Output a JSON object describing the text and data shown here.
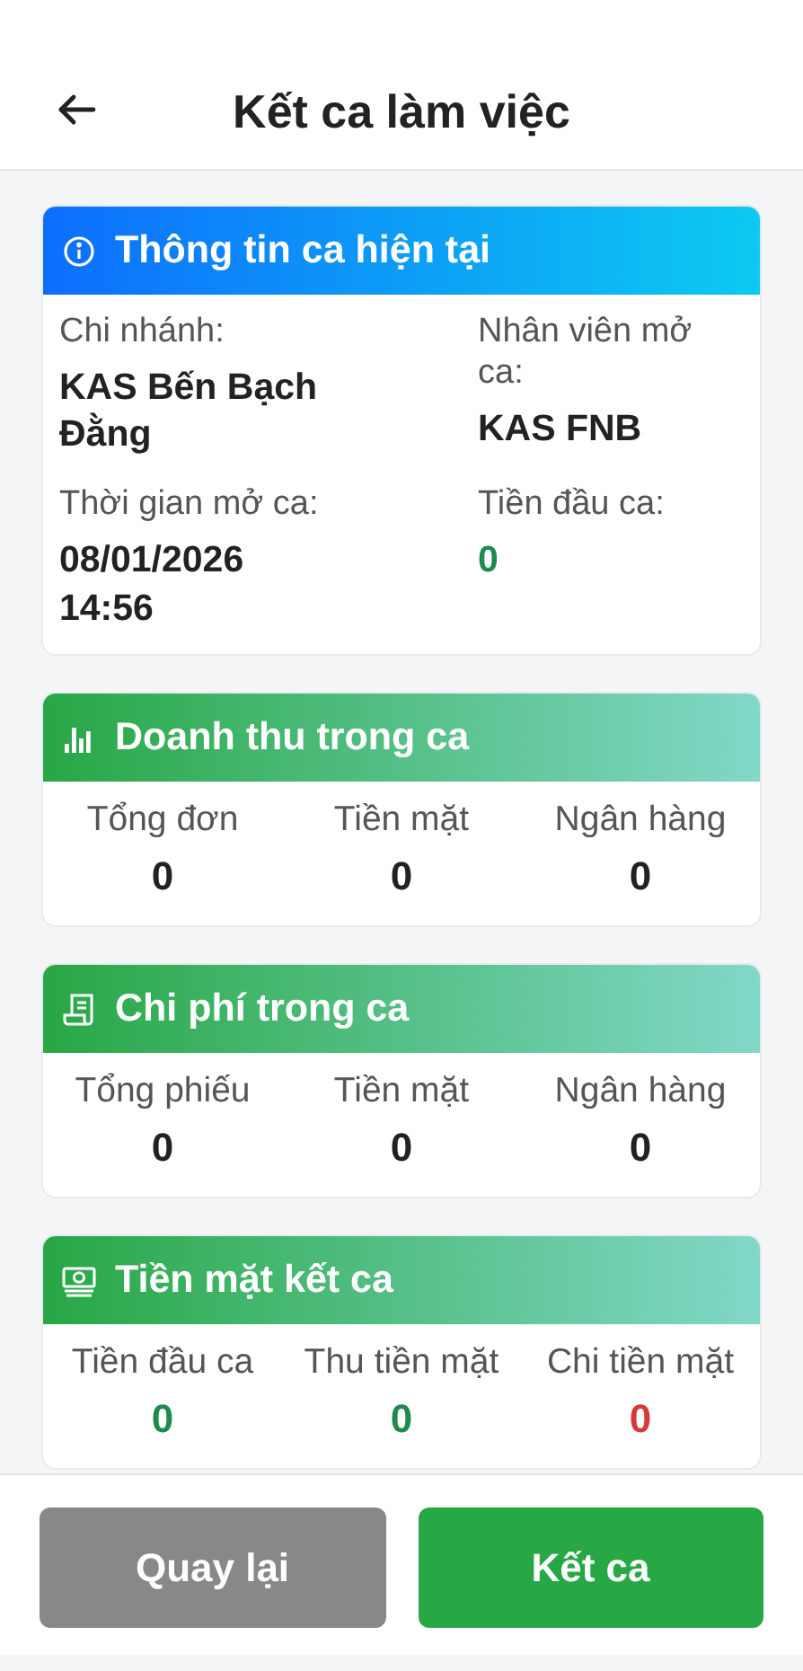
{
  "header": {
    "title": "Kết ca làm việc"
  },
  "sections": [
    {
      "kind": "info",
      "title": "Thông tin ca hiện tại",
      "fields": [
        {
          "label": "Chi nhánh:",
          "value": "KAS Bến Bạch Đằng",
          "color": "#222222"
        },
        {
          "label": "Nhân viên mở ca:",
          "value": "KAS FNB",
          "color": "#222222"
        },
        {
          "label": "Thời gian mở ca:",
          "value": "08/01/2026 14:56",
          "color": "#222222"
        },
        {
          "label": "Tiền đầu ca:",
          "value": "0",
          "color": "#1e8a4f"
        }
      ]
    },
    {
      "kind": "revenue",
      "title": "Doanh thu trong ca",
      "fields": [
        {
          "label": "Tổng đơn",
          "value": "0",
          "color": "#222222"
        },
        {
          "label": "Tiền mặt",
          "value": "0",
          "color": "#222222"
        },
        {
          "label": "Ngân hàng",
          "value": "0",
          "color": "#222222"
        }
      ]
    },
    {
      "kind": "expense",
      "title": "Chi phí trong ca",
      "fields": [
        {
          "label": "Tổng phiếu",
          "value": "0",
          "color": "#222222"
        },
        {
          "label": "Tiền mặt",
          "value": "0",
          "color": "#222222"
        },
        {
          "label": "Ngân hàng",
          "value": "0",
          "color": "#222222"
        }
      ]
    },
    {
      "kind": "cash",
      "title": "Tiền mặt kết ca",
      "fields": [
        {
          "label": "Tiền đầu ca",
          "value": "0",
          "color": "#1e8a4f"
        },
        {
          "label": "Thu tiền mặt",
          "value": "0",
          "color": "#1e8a4f"
        },
        {
          "label": "Chi tiền mặt",
          "value": "0",
          "color": "#d63a34"
        }
      ]
    }
  ],
  "buttons": [
    {
      "label": "Quay lại",
      "kind": "secondary"
    },
    {
      "label": "Kết ca",
      "kind": "primary"
    }
  ]
}
